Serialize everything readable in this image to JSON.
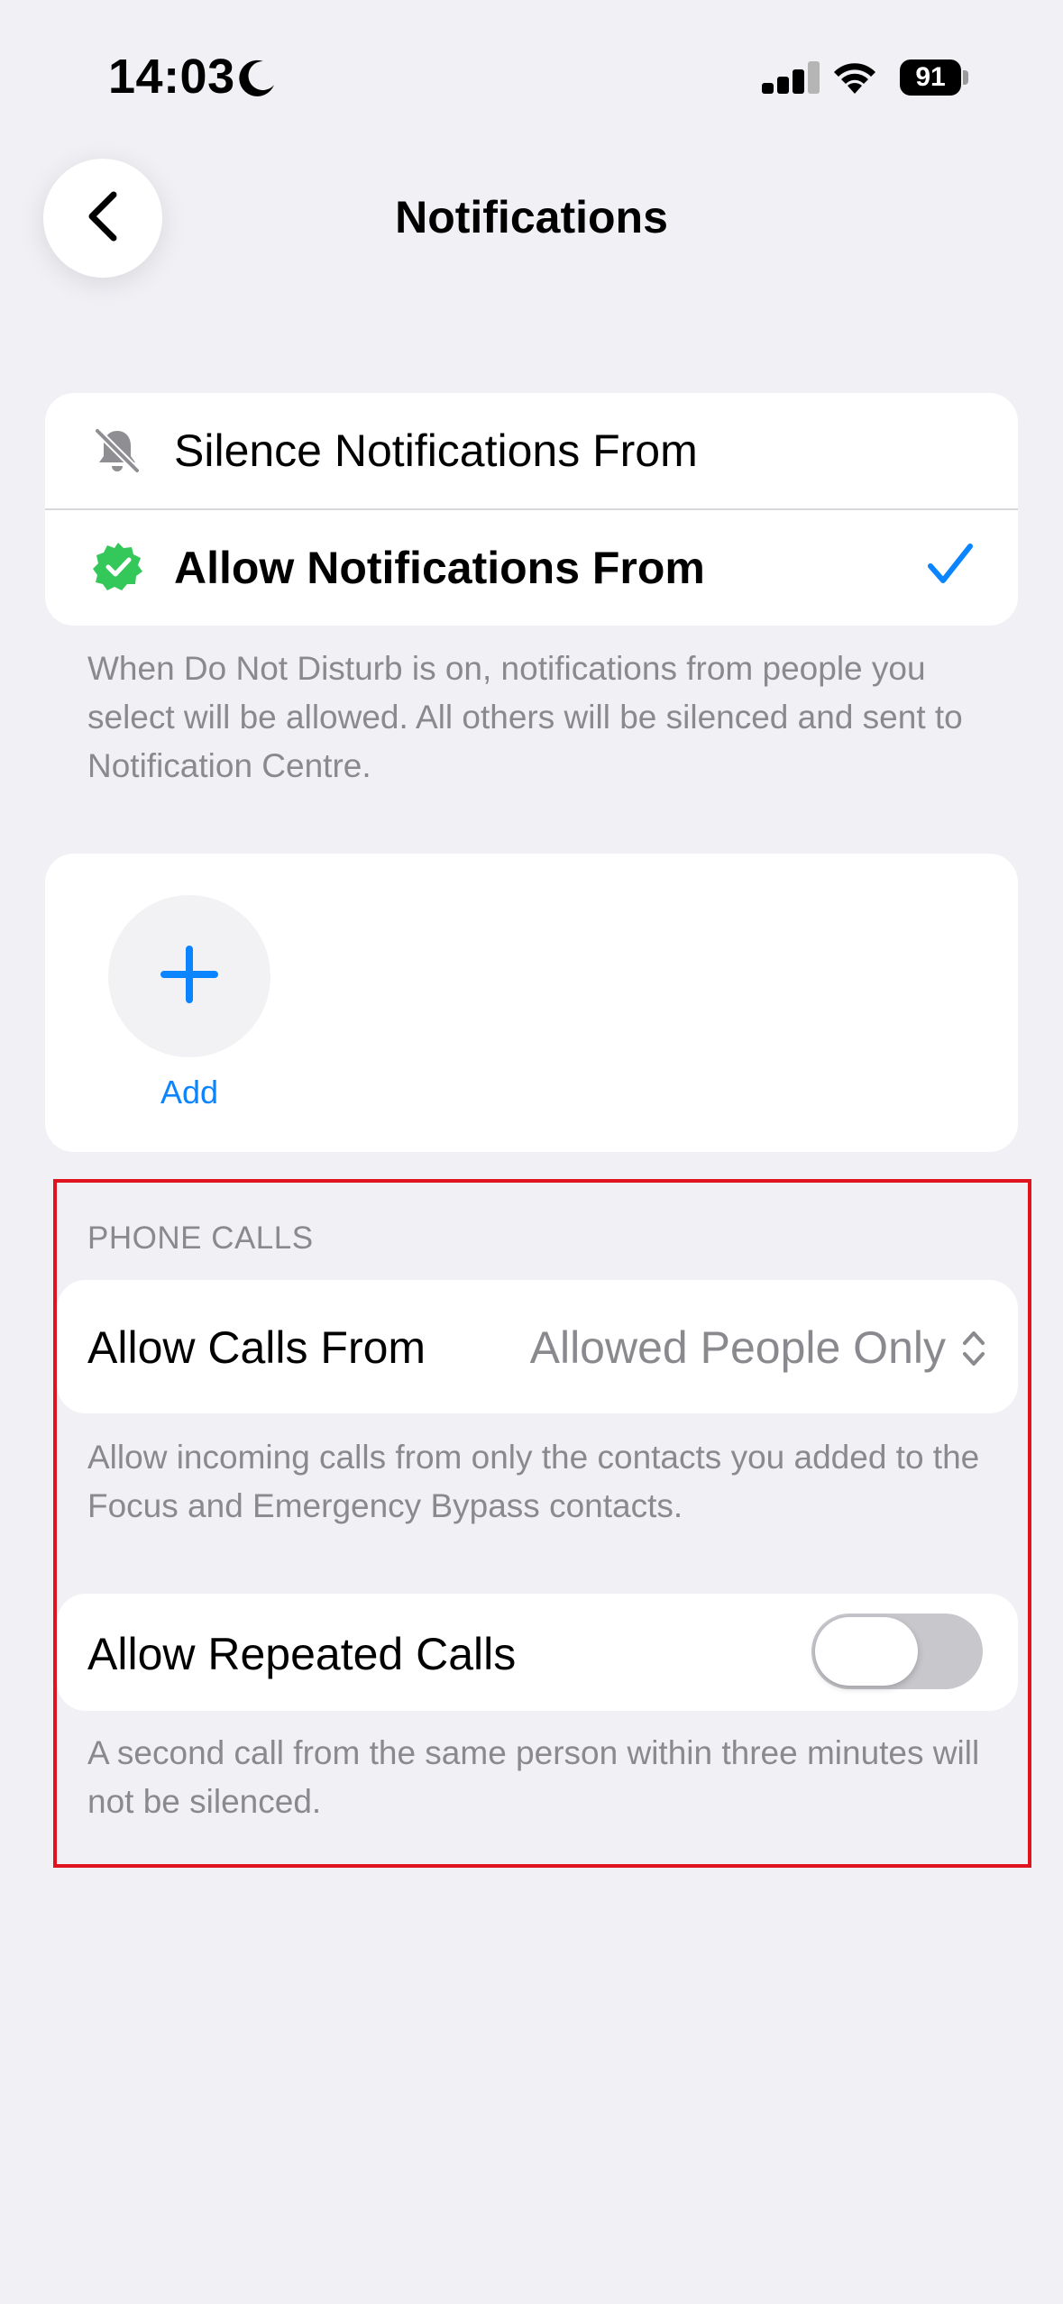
{
  "status_bar": {
    "time": "14:03",
    "battery": "91"
  },
  "nav": {
    "title": "Notifications"
  },
  "mode_options": [
    {
      "label": "Silence Notifications From",
      "selected": false
    },
    {
      "label": "Allow Notifications From",
      "selected": true
    }
  ],
  "mode_footer": "When Do Not Disturb is on, notifications from people you select will be allowed. All others will be silenced and sent to Notification Centre.",
  "people": {
    "add_label": "Add"
  },
  "phone_calls": {
    "header": "PHONE CALLS",
    "allow_calls_from_label": "Allow Calls From",
    "allow_calls_from_value": "Allowed People Only",
    "allow_calls_footer": "Allow incoming calls from only the contacts you added to the Focus and Emergency Bypass contacts.",
    "repeated_calls_label": "Allow Repeated Calls",
    "repeated_calls_on": false,
    "repeated_calls_footer": "A second call from the same person within three minutes will not be silenced."
  },
  "colors": {
    "accent": "#0A84FF",
    "green": "#34C759",
    "highlight": "#E0141E",
    "background": "#F0F0F5"
  }
}
